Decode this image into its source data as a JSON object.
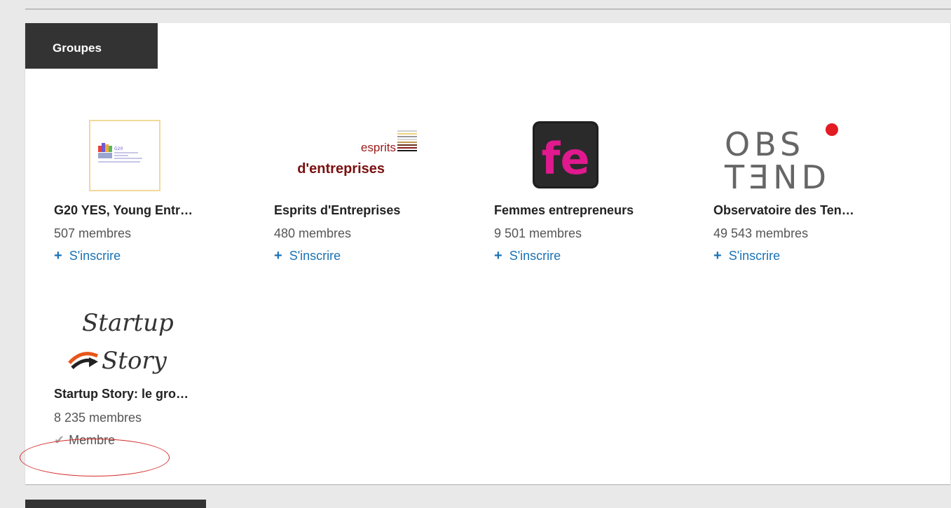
{
  "section": {
    "title": "Groupes"
  },
  "groups": [
    {
      "name": "G20 YES, Young Entr…",
      "members": "507 membres",
      "action": "S'inscrire",
      "logo_text": "G20"
    },
    {
      "name": "Esprits d'Entreprises",
      "members": "480 membres",
      "action": "S'inscrire",
      "logo_text": [
        "esprits",
        "d'entreprises"
      ]
    },
    {
      "name": "Femmes entrepreneurs",
      "members": "9 501 membres",
      "action": "S'inscrire",
      "logo_text": "fe"
    },
    {
      "name": "Observatoire des Ten…",
      "members": "49 543 membres",
      "action": "S'inscrire",
      "logo_text": [
        "OBS",
        "TƎND"
      ]
    },
    {
      "name": "Startup Story: le gro…",
      "members": "8 235 membres",
      "action": "Membre",
      "logo_text": [
        "Startup",
        "Story"
      ]
    }
  ],
  "colors": {
    "link": "#1b72b5",
    "header_bg": "#333333",
    "annotation": "#d42a2a",
    "fe_pink": "#e0198e",
    "obs_dot": "#e31b23"
  }
}
